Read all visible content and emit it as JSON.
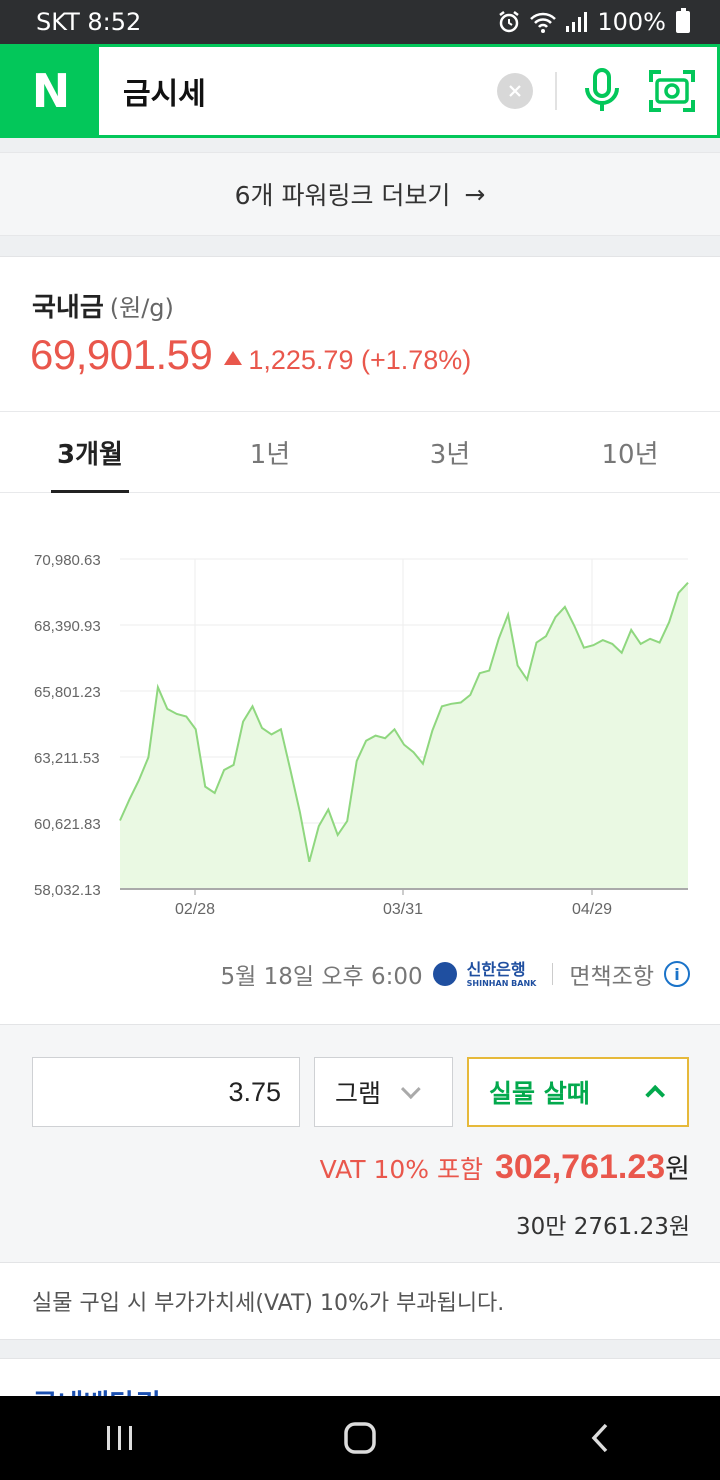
{
  "status": {
    "carrier_time": "SKT 8:52",
    "battery": "100%"
  },
  "search": {
    "logo": "N",
    "query": "금시세"
  },
  "powerlink": {
    "label": "6개 파워링크 더보기",
    "arrow": "→"
  },
  "gold": {
    "title": "국내금",
    "unit": "(원/g)",
    "price": "69,901.59",
    "change": "1,225.79 (+1.78%)"
  },
  "tabs": [
    {
      "label": "3개월",
      "active": true
    },
    {
      "label": "1년",
      "active": false
    },
    {
      "label": "3년",
      "active": false
    },
    {
      "label": "10년",
      "active": false
    }
  ],
  "chart_data": {
    "type": "area",
    "y_ticks": [
      "70,980.63",
      "68,390.93",
      "65,801.23",
      "63,211.53",
      "60,621.83",
      "58,032.13"
    ],
    "x_ticks": [
      "02/28",
      "03/31",
      "04/29"
    ],
    "ylim": [
      58032.13,
      70980.63
    ],
    "values": [
      60720,
      61550,
      62300,
      63200,
      65950,
      65100,
      64900,
      64800,
      64300,
      62050,
      61800,
      62700,
      62900,
      64600,
      65200,
      64350,
      64100,
      64300,
      62700,
      61050,
      59100,
      60500,
      61150,
      60150,
      60700,
      63050,
      63850,
      64050,
      63950,
      64300,
      63700,
      63400,
      62950,
      64250,
      65200,
      65300,
      65350,
      65650,
      66500,
      66600,
      67850,
      68800,
      66800,
      66250,
      67700,
      67950,
      68700,
      69100,
      68350,
      67500,
      67600,
      67800,
      67650,
      67300,
      68200,
      67650,
      67850,
      67700,
      68500,
      69650,
      70050
    ],
    "colors": {
      "line": "#8fd77f",
      "fill": "#eaf9e3"
    }
  },
  "source": {
    "time": "5월 18일 오후 6:00",
    "bank_kr": "신한은행",
    "bank_en": "SHINHAN BANK",
    "disclaimer": "면책조항",
    "info": "i"
  },
  "calc": {
    "quantity": "3.75",
    "unit": "그램",
    "type": "실물 살때",
    "vat_label": "VAT 10% 포함",
    "total": "302,761.23",
    "won": "원",
    "hangul_amount": "30만 2761.23원"
  },
  "notice": "실물 구입 시 부가가치세(VAT) 10%가 부과됩니다.",
  "next_section": "국내배당귀",
  "colors": {
    "brand_green": "#03c75a",
    "up_red": "#e9574c",
    "gold_border": "#e6b93a"
  }
}
